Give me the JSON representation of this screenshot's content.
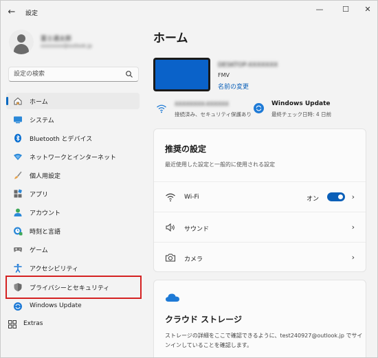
{
  "window": {
    "title": "設定",
    "back_glyph": "←",
    "minimize_glyph": "—",
    "maximize_glyph": "☐",
    "close_glyph": "✕"
  },
  "profile": {
    "name": "富士通太郎",
    "email": "xxxxxxxx@outlook.jp"
  },
  "search": {
    "placeholder": "設定の検索"
  },
  "sidebar": {
    "items": [
      {
        "label": "ホーム",
        "icon": "home-icon",
        "active": true
      },
      {
        "label": "システム",
        "icon": "system-monitor-icon"
      },
      {
        "label": "Bluetooth とデバイス",
        "icon": "bluetooth-icon"
      },
      {
        "label": "ネットワークとインターネット",
        "icon": "network-icon"
      },
      {
        "label": "個人用設定",
        "icon": "brush-icon"
      },
      {
        "label": "アプリ",
        "icon": "apps-icon"
      },
      {
        "label": "アカウント",
        "icon": "account-icon"
      },
      {
        "label": "時刻と言語",
        "icon": "time-language-icon"
      },
      {
        "label": "ゲーム",
        "icon": "gaming-icon"
      },
      {
        "label": "アクセシビリティ",
        "icon": "accessibility-icon"
      },
      {
        "label": "プライバシーとセキュリティ",
        "icon": "shield-icon",
        "highlighted": true
      },
      {
        "label": "Windows Update",
        "icon": "windows-update-icon"
      },
      {
        "label": "Extras",
        "icon": "extras-icon"
      }
    ]
  },
  "main": {
    "title": "ホーム",
    "device": {
      "name": "DESKTOP-XXXXXXX",
      "model": "FMV",
      "rename_link": "名前の変更"
    },
    "network_status": {
      "name": "XXXXXXXX-XXXXXX",
      "sub": "接続済み、セキュリティ保護あり"
    },
    "update_status": {
      "title": "Windows Update",
      "sub": "最終チェック日時: 4 日前"
    },
    "recommended": {
      "title": "推奨の設定",
      "subtitle": "最近使用した設定と一般的に使用される設定",
      "rows": [
        {
          "label": "Wi-Fi",
          "icon": "wifi-icon",
          "toggle_label": "オン",
          "toggle_on": true
        },
        {
          "label": "サウンド",
          "icon": "speaker-icon"
        },
        {
          "label": "カメラ",
          "icon": "camera-icon"
        }
      ],
      "chevron_glyph": "›"
    },
    "cloud": {
      "title": "クラウド ストレージ",
      "text": "ストレージの詳細をここで確認できるように、test240927@outlook.jp でサインインしていることを確認します。"
    }
  },
  "colors": {
    "accent": "#0067c0",
    "highlight_border": "#d42020",
    "background": "#f3f3f3",
    "card": "#fbfbfb"
  }
}
